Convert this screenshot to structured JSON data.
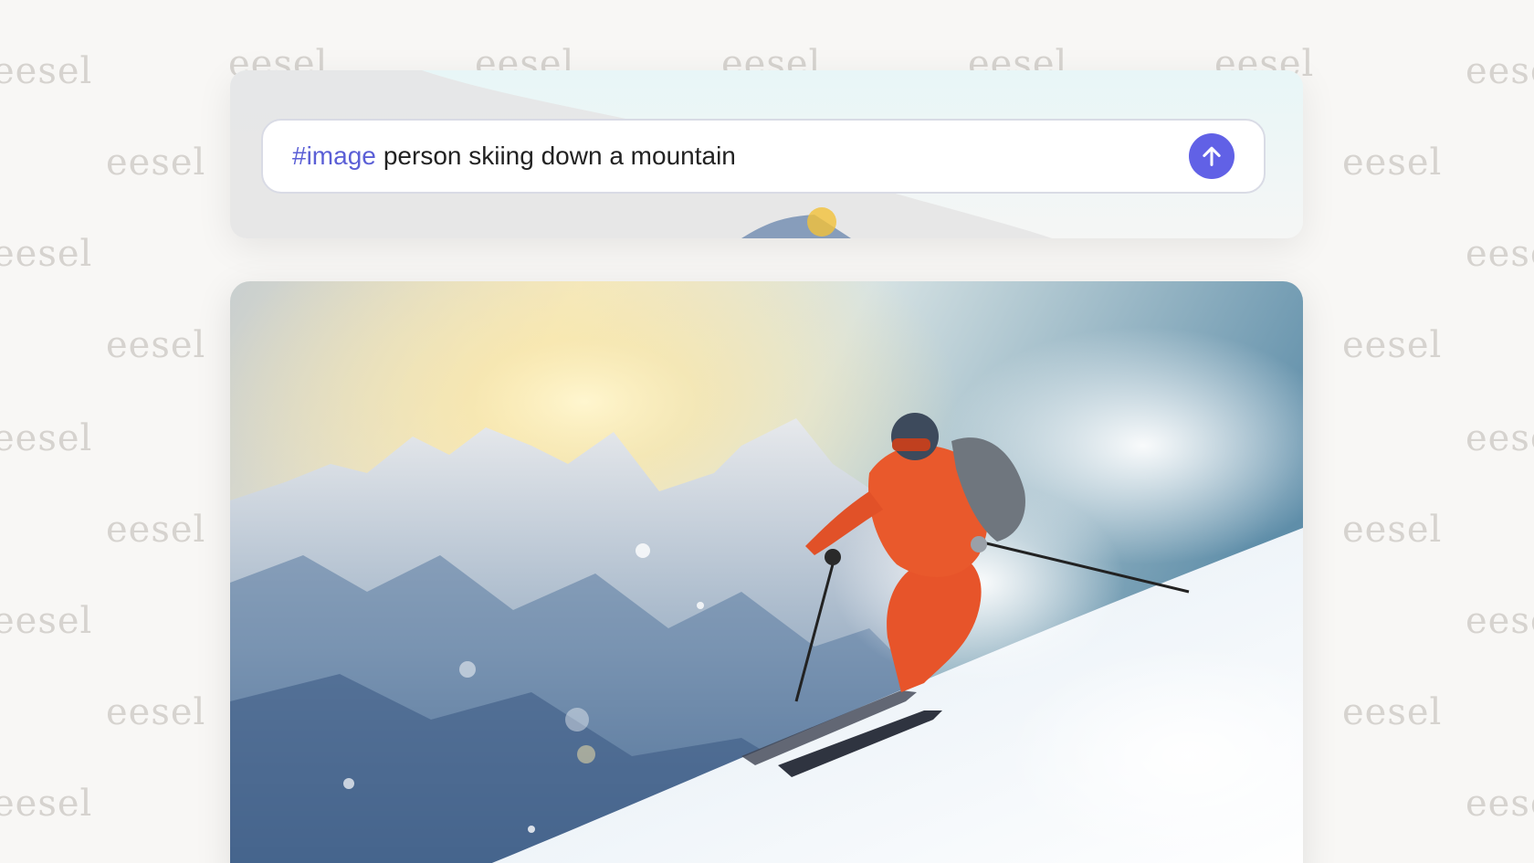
{
  "watermark": {
    "text": "eesel",
    "color": "#d6d3cf"
  },
  "prompt": {
    "tag": "#image",
    "text": "person skiing down a mountain",
    "tag_color": "#5b5fd6",
    "send_icon": "arrow-up-icon",
    "send_color": "#6161e6"
  },
  "result_image": {
    "description_alt": "person skiing down a mountain"
  }
}
